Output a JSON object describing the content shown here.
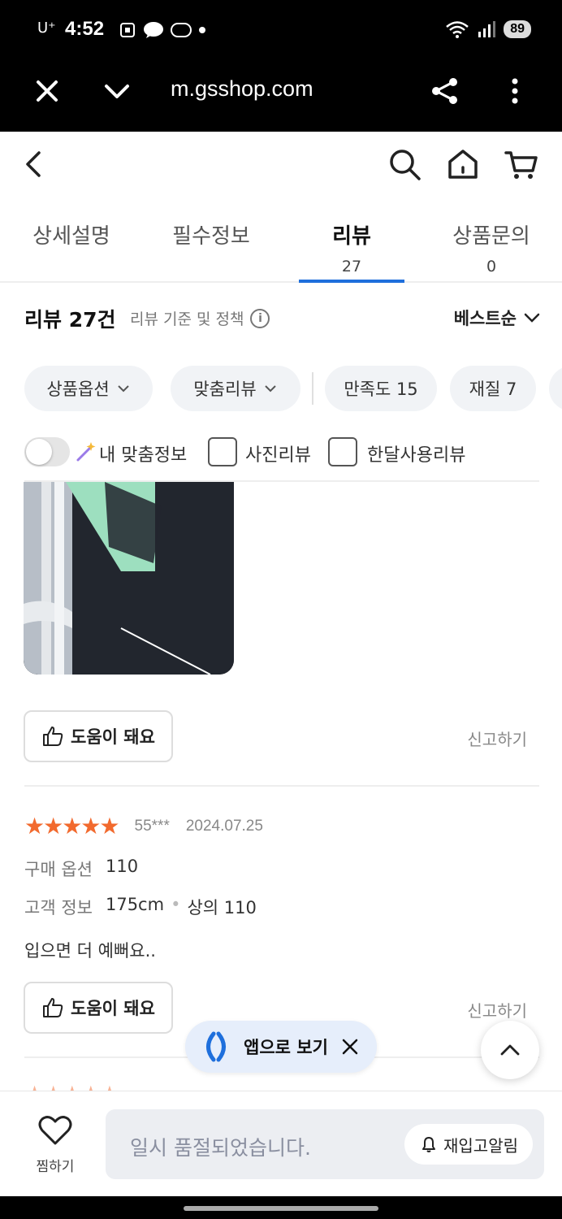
{
  "statusbar": {
    "carrier": "U⁺",
    "time": "4:52",
    "battery": "89"
  },
  "browser": {
    "url": "m.gsshop.com"
  },
  "tabs": [
    {
      "label": "상세설명",
      "count": ""
    },
    {
      "label": "필수정보",
      "count": ""
    },
    {
      "label": "리뷰",
      "count": "27"
    },
    {
      "label": "상품문의",
      "count": "0"
    }
  ],
  "reviews_header": {
    "title": "리뷰 27건",
    "policy": "리뷰 기준 및 정책",
    "sort": "베스트순"
  },
  "chips": [
    "상품옵션",
    "맞춤리뷰",
    "만족도 15",
    "재질 7"
  ],
  "filters": {
    "my_fit": "내 맞춤정보",
    "photo": "사진리뷰",
    "month": "한달사용리뷰"
  },
  "review1": {
    "helpful": "도움이 돼요",
    "report": "신고하기"
  },
  "review2": {
    "stars": "★★★★★",
    "rating": 5,
    "user": "55***",
    "date": "2024.07.25",
    "option_label": "구매 옵션",
    "option_value": "110",
    "customer_label": "고객 정보",
    "height": "175cm",
    "dot": "•",
    "top_size": "상의 110",
    "body": "입으면 더 예뻐요..",
    "helpful": "도움이 돼요",
    "report": "신고하기"
  },
  "app_pill": "앱으로 보기",
  "bottom": {
    "wish": "찜하기",
    "soldout": "일시 품절되었습니다.",
    "restock": "재입고알림"
  },
  "colors": {
    "accent": "#1e6fdc",
    "star": "#f26a2e"
  }
}
